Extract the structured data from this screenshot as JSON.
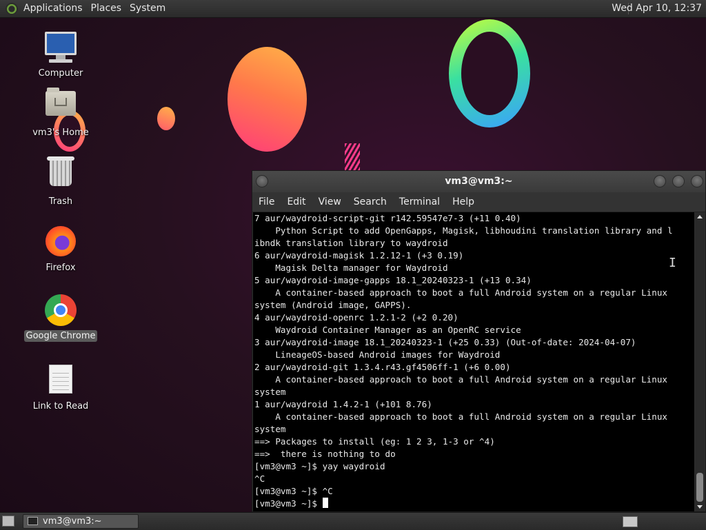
{
  "top_panel": {
    "menus": [
      "Applications",
      "Places",
      "System"
    ],
    "clock": "Wed Apr 10, 12:37"
  },
  "desktop_icons": [
    {
      "label": "Computer",
      "icon": "computer-icon"
    },
    {
      "label": "vm3's Home",
      "icon": "home-folder-icon"
    },
    {
      "label": "Trash",
      "icon": "trash-icon"
    },
    {
      "label": "Firefox",
      "icon": "firefox-icon"
    },
    {
      "label": "Google Chrome",
      "icon": "chrome-icon",
      "selected": true
    },
    {
      "label": "Link to Read",
      "icon": "document-icon"
    }
  ],
  "terminal": {
    "title": "vm3@vm3:~",
    "menus": [
      "File",
      "Edit",
      "View",
      "Search",
      "Terminal",
      "Help"
    ],
    "lines": [
      "7 aur/waydroid-script-git r142.59547e7-3 (+11 0.40)",
      "    Python Script to add OpenGapps, Magisk, libhoudini translation library and l",
      "ibndk translation library to waydroid",
      "6 aur/waydroid-magisk 1.2.12-1 (+3 0.19)",
      "    Magisk Delta manager for Waydroid",
      "5 aur/waydroid-image-gapps 18.1_20240323-1 (+13 0.34)",
      "    A container-based approach to boot a full Android system on a regular Linux",
      "system (Android image, GAPPS).",
      "4 aur/waydroid-openrc 1.2.1-2 (+2 0.20)",
      "    Waydroid Container Manager as an OpenRC service",
      "3 aur/waydroid-image 18.1_20240323-1 (+25 0.33) (Out-of-date: 2024-04-07)",
      "    LineageOS-based Android images for Waydroid",
      "2 aur/waydroid-git 1.3.4.r43.gf4506ff-1 (+6 0.00)",
      "    A container-based approach to boot a full Android system on a regular Linux",
      "system",
      "1 aur/waydroid 1.4.2-1 (+101 8.76)",
      "    A container-based approach to boot a full Android system on a regular Linux",
      "system",
      "==> Packages to install (eg: 1 2 3, 1-3 or ^4)",
      "==>  there is nothing to do",
      "[vm3@vm3 ~]$ yay waydroid",
      "^C",
      "[vm3@vm3 ~]$ ^C"
    ],
    "prompt": "[vm3@vm3 ~]$ ",
    "scroll_position": 0.92
  },
  "taskbar": {
    "tasks": [
      {
        "label": "vm3@vm3:~",
        "icon": "terminal-icon"
      }
    ]
  }
}
